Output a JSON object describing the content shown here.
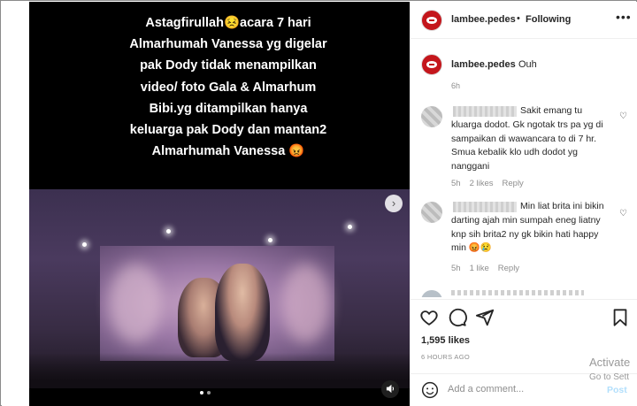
{
  "media": {
    "caption": "Astagfirullah😣acara 7 hari Almarhumah Vanessa yg digelar pak Dody tidak menampilkan video/ foto Gala & Almarhum Bibi.yg ditampilkan hanya keluarga pak Dody dan mantan2 Almarhumah Vanessa 😡",
    "next_icon": "chevron-right-icon",
    "sound_icon": "speaker-icon"
  },
  "header": {
    "username": "lambee.pedes",
    "separator": "•",
    "follow_label": "Following",
    "more_icon": "more-horizontal-icon"
  },
  "caption_comment": {
    "username": "lambee.pedes",
    "text": "Ouh",
    "time": "6h"
  },
  "comments": [
    {
      "text": "Sakit emang tu kluarga dodot. Gk ngotak trs pa yg di sampaikan di wawancara to di 7 hr. Smua kebalik klo udh dodot yg nanggani",
      "time": "5h",
      "likes": "2 likes",
      "reply": "Reply"
    },
    {
      "text": "Min liat brita ini bikin darting ajah min sumpah eneg liatny knp sih brita2 ny gk bikin hati happy min 😡😢",
      "time": "5h",
      "likes": "1 like",
      "reply": "Reply"
    }
  ],
  "actions": {
    "likes": "1,595 likes",
    "post_time": "6 HOURS AGO"
  },
  "add_comment": {
    "placeholder": "Add a comment...",
    "post_label": "Post"
  },
  "watermark": {
    "line1": "Activate",
    "line2": "Go to Sett"
  },
  "colors": {
    "brand_avatar": "#c4161c",
    "post_button": "#b2dffc"
  }
}
